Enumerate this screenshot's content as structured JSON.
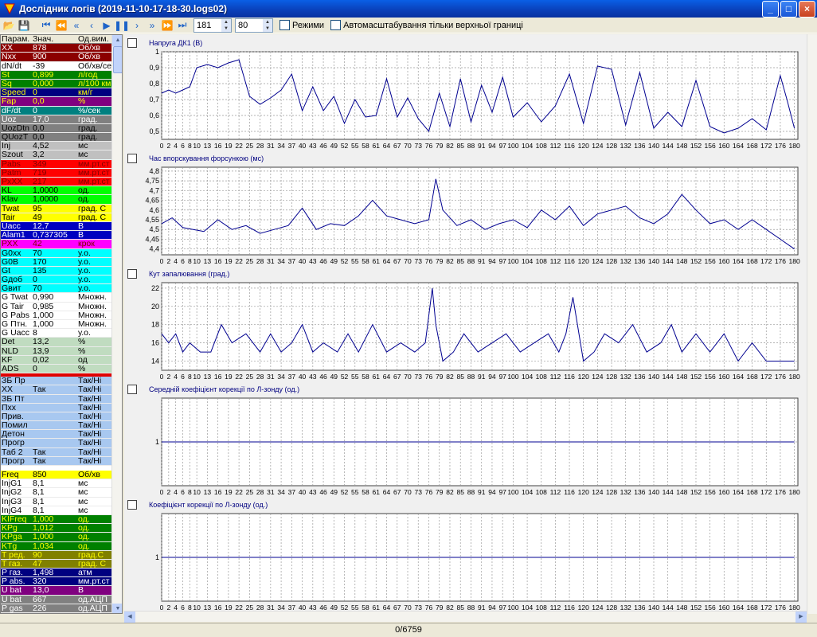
{
  "window": {
    "title": "Дослідник логів (2019-11-10-17-18-30.logs02)",
    "minimize": "_",
    "maximize": "□",
    "close": "×"
  },
  "toolbar": {
    "position_value": "181",
    "window_value": "80",
    "modes_label": "Режими",
    "autoscale_label": "Автомасштабування тільки верхньої границі",
    "icons": [
      "open-folder-icon",
      "save-icon",
      "rewind-to-start-icon",
      "skip-back-icon",
      "fast-back-icon",
      "step-back-icon",
      "play-icon",
      "pause-icon",
      "step-forward-icon",
      "fast-forward-icon",
      "skip-forward-icon",
      "forward-to-end-icon"
    ]
  },
  "params": {
    "headers": [
      "Парам.",
      "Знач.",
      "Од.вим."
    ],
    "rows": [
      {
        "n": "XX",
        "v": "878",
        "u": "Об/хв",
        "c": "#8b0000",
        "t": "#fff"
      },
      {
        "n": "Nxx",
        "v": "900",
        "u": "Об/хв",
        "c": "#8b0000",
        "t": "#fff"
      },
      {
        "n": "dN/dt",
        "v": "-39",
        "u": "Об/хв/сек",
        "c": "#ffffff",
        "t": "#000"
      },
      {
        "n": "St",
        "v": "0,899",
        "u": "л/год",
        "c": "#008000",
        "t": "#ffff00"
      },
      {
        "n": "Sq",
        "v": "0,000",
        "u": "л/100 км",
        "c": "#008000",
        "t": "#ffff00"
      },
      {
        "n": "Speed",
        "v": "0",
        "u": "км/г",
        "c": "#000080",
        "t": "#ffff00"
      },
      {
        "n": "Fap",
        "v": "0,0",
        "u": "%",
        "c": "#800080",
        "t": "#ffff00"
      },
      {
        "n": "dF/dt",
        "v": "0",
        "u": "%/сек",
        "c": "#008080",
        "t": "#fff"
      },
      {
        "n": "Uoz",
        "v": "17,0",
        "u": "град.",
        "c": "#808080",
        "t": "#fff"
      },
      {
        "n": "UozDtn",
        "v": "0,0",
        "u": "град.",
        "c": "#808080",
        "t": "#000"
      },
      {
        "n": "QUozT",
        "v": "0,0",
        "u": "град.",
        "c": "#808080",
        "t": "#000"
      },
      {
        "n": "Inj",
        "v": "4,52",
        "u": "мс",
        "c": "#c0c0c0",
        "t": "#000"
      },
      {
        "n": "Szout",
        "v": "3,2",
        "u": "мс",
        "c": "#c0c0c0",
        "t": "#000"
      },
      {
        "n": "Pabs",
        "v": "349",
        "u": "мм.рт.ст",
        "c": "#ff0000",
        "t": "#800000"
      },
      {
        "n": "Patm",
        "v": "719",
        "u": "мм.рт.ст",
        "c": "#ff0000",
        "t": "#800000"
      },
      {
        "n": "PxXX",
        "v": "217",
        "u": "мм.рт.ст",
        "c": "#ff0000",
        "t": "#800000"
      },
      {
        "n": "KL",
        "v": "1,0000",
        "u": "од.",
        "c": "#00ff00",
        "t": "#000"
      },
      {
        "n": "Klav",
        "v": "1,0000",
        "u": "од.",
        "c": "#00ff00",
        "t": "#000"
      },
      {
        "n": "Twat",
        "v": "95",
        "u": "град. С",
        "c": "#ffff00",
        "t": "#000"
      },
      {
        "n": "Tair",
        "v": "49",
        "u": "град. С",
        "c": "#ffff00",
        "t": "#000"
      },
      {
        "n": "Uacc",
        "v": "12,7",
        "u": "В",
        "c": "#0000c0",
        "t": "#fff"
      },
      {
        "n": "Alam1",
        "v": "0,737305",
        "u": "В",
        "c": "#0000c0",
        "t": "#fff"
      },
      {
        "n": "РХХ",
        "v": "42",
        "u": "крок",
        "c": "#ff00ff",
        "t": "#800000"
      },
      {
        "n": "G0xx",
        "v": "70",
        "u": "у.о.",
        "c": "#00ffff",
        "t": "#000"
      },
      {
        "n": "G0B",
        "v": "170",
        "u": "у.о.",
        "c": "#00ffff",
        "t": "#000"
      },
      {
        "n": "Gt",
        "v": "135",
        "u": "у.о.",
        "c": "#00ffff",
        "t": "#000"
      },
      {
        "n": "Gдоб",
        "v": "0",
        "u": "у.о.",
        "c": "#00ffff",
        "t": "#000"
      },
      {
        "n": "Gвит",
        "v": "70",
        "u": "у.о.",
        "c": "#00ffff",
        "t": "#000"
      },
      {
        "n": "G Twat",
        "v": "0,990",
        "u": "Множн.",
        "c": "#ffffff",
        "t": "#000"
      },
      {
        "n": "G Tair",
        "v": "0,985",
        "u": "Множн.",
        "c": "#ffffff",
        "t": "#000"
      },
      {
        "n": "G Pabs",
        "v": "1,000",
        "u": "Множн.",
        "c": "#ffffff",
        "t": "#000"
      },
      {
        "n": "G Птн.",
        "v": "1,000",
        "u": "Множн.",
        "c": "#ffffff",
        "t": "#000"
      },
      {
        "n": "G Uacc",
        "v": "8",
        "u": "у.о.",
        "c": "#ffffff",
        "t": "#000"
      },
      {
        "n": "Det",
        "v": "13,2",
        "u": "%",
        "c": "#c0dcc0",
        "t": "#000"
      },
      {
        "n": "NLD",
        "v": "13,9",
        "u": "%",
        "c": "#c0dcc0",
        "t": "#000"
      },
      {
        "n": "KF",
        "v": "0,02",
        "u": "од",
        "c": "#c0dcc0",
        "t": "#000"
      },
      {
        "n": "ADS",
        "v": "0",
        "u": "%",
        "c": "#c0dcc0",
        "t": "#000"
      }
    ],
    "flags": [
      {
        "n": "ЗБ Пр",
        "v": "",
        "u": "Так/Ні"
      },
      {
        "n": "XX",
        "v": "Так",
        "u": "Так/Ні"
      },
      {
        "n": "ЗБ Пт",
        "v": "",
        "u": "Так/Ні"
      },
      {
        "n": "Пхх",
        "v": "",
        "u": "Так/Ні"
      },
      {
        "n": "Прив.",
        "v": "",
        "u": "Так/Ні"
      },
      {
        "n": "Помил",
        "v": "",
        "u": "Так/Ні"
      },
      {
        "n": "Детон",
        "v": "",
        "u": "Так/Ні"
      },
      {
        "n": "Прогр",
        "v": "",
        "u": "Так/Ні"
      },
      {
        "n": "Таб 2",
        "v": "Так",
        "u": "Так/Ні"
      },
      {
        "n": "Прогр",
        "v": "Так",
        "u": "Так/Ні"
      }
    ],
    "rows2": [
      {
        "n": "Freq",
        "v": "850",
        "u": "Об/хв",
        "c": "#ffff00",
        "t": "#000"
      },
      {
        "n": "InjG1",
        "v": "8,1",
        "u": "мс",
        "c": "#ffffff",
        "t": "#000"
      },
      {
        "n": "InjG2",
        "v": "8,1",
        "u": "мс",
        "c": "#ffffff",
        "t": "#000"
      },
      {
        "n": "InjG3",
        "v": "8,1",
        "u": "мс",
        "c": "#ffffff",
        "t": "#000"
      },
      {
        "n": "InjG4",
        "v": "8,1",
        "u": "мс",
        "c": "#ffffff",
        "t": "#000"
      },
      {
        "n": "KIFreq",
        "v": "1,000",
        "u": "од.",
        "c": "#008000",
        "t": "#ffff00"
      },
      {
        "n": "KPg",
        "v": "1,012",
        "u": "од.",
        "c": "#008000",
        "t": "#ffff00"
      },
      {
        "n": "KPga",
        "v": "1,000",
        "u": "од.",
        "c": "#008000",
        "t": "#ffff00"
      },
      {
        "n": "KTg",
        "v": "1,034",
        "u": "од.",
        "c": "#008000",
        "t": "#ffff00"
      },
      {
        "n": "T ред.",
        "v": "90",
        "u": "град.С",
        "c": "#808000",
        "t": "#ffff00"
      },
      {
        "n": "T газ.",
        "v": "47",
        "u": "град. С",
        "c": "#808000",
        "t": "#ffff00"
      },
      {
        "n": "P газ.",
        "v": "1,498",
        "u": "атм",
        "c": "#000080",
        "t": "#fff"
      },
      {
        "n": "P abs.",
        "v": "320",
        "u": "мм.рт.ст",
        "c": "#000080",
        "t": "#fff"
      },
      {
        "n": "U bat",
        "v": "13,0",
        "u": "В",
        "c": "#800080",
        "t": "#fff"
      },
      {
        "n": "U bat",
        "v": "667",
        "u": "од.АЦП",
        "c": "#808080",
        "t": "#fff"
      },
      {
        "n": "P gas",
        "v": "226",
        "u": "од.АЦП",
        "c": "#808080",
        "t": "#fff"
      }
    ]
  },
  "chart_data": [
    {
      "type": "line",
      "title": "Напруга ДК1 (В)",
      "ylim": [
        0.45,
        1.0
      ],
      "yticks": [
        0.5,
        0.6,
        0.7,
        0.8,
        0.9,
        1
      ],
      "ytick_labels": [
        "0,5",
        "0,6",
        "0,7",
        "0,8",
        "0,9",
        "1"
      ],
      "x": [
        0,
        2,
        4,
        6,
        8,
        10,
        13,
        16,
        19,
        22,
        25,
        28,
        31,
        34,
        37,
        40,
        43,
        46,
        49,
        52,
        55,
        58,
        61,
        64,
        67,
        70,
        73,
        76,
        79,
        82,
        85,
        88,
        91,
        94,
        97,
        100,
        104,
        108,
        112,
        116,
        120,
        124,
        128,
        132,
        136,
        140,
        144,
        148,
        152,
        156,
        160,
        164,
        168,
        172,
        176,
        178,
        180
      ],
      "values": [
        0.74,
        0.76,
        0.74,
        0.76,
        0.78,
        0.9,
        0.92,
        0.9,
        0.93,
        0.95,
        0.72,
        0.67,
        0.71,
        0.76,
        0.86,
        0.63,
        0.78,
        0.63,
        0.72,
        0.55,
        0.7,
        0.59,
        0.6,
        0.83,
        0.59,
        0.71,
        0.58,
        0.5,
        0.74,
        0.53,
        0.83,
        0.56,
        0.79,
        0.62,
        0.84,
        0.59,
        0.68,
        0.56,
        0.66,
        0.86,
        0.55,
        0.91,
        0.89,
        0.54,
        0.87,
        0.52,
        0.62,
        0.53,
        0.82,
        0.53,
        0.49,
        0.52,
        0.58,
        0.51,
        0.85,
        0.69,
        0.52
      ]
    },
    {
      "type": "line",
      "title": "Час впорскування форсункою (мс)",
      "ylim": [
        4.37,
        4.82
      ],
      "yticks": [
        4.4,
        4.45,
        4.5,
        4.55,
        4.6,
        4.65,
        4.7,
        4.75,
        4.8
      ],
      "ytick_labels": [
        "4,4",
        "4,45",
        "4,5",
        "4,55",
        "4,6",
        "4,65",
        "4,7",
        "4,75",
        "4,8"
      ],
      "x": [
        0,
        3,
        6,
        9,
        12,
        16,
        20,
        24,
        28,
        32,
        36,
        40,
        44,
        48,
        52,
        56,
        60,
        64,
        68,
        72,
        76,
        78,
        80,
        84,
        88,
        92,
        96,
        100,
        104,
        108,
        112,
        116,
        120,
        124,
        128,
        132,
        136,
        140,
        144,
        148,
        152,
        156,
        160,
        164,
        168,
        172,
        176,
        180
      ],
      "values": [
        4.53,
        4.56,
        4.51,
        4.5,
        4.49,
        4.55,
        4.5,
        4.52,
        4.48,
        4.5,
        4.52,
        4.61,
        4.5,
        4.53,
        4.52,
        4.57,
        4.65,
        4.57,
        4.55,
        4.53,
        4.55,
        4.76,
        4.6,
        4.52,
        4.55,
        4.5,
        4.53,
        4.55,
        4.51,
        4.6,
        4.55,
        4.62,
        4.52,
        4.58,
        4.6,
        4.62,
        4.56,
        4.53,
        4.58,
        4.68,
        4.6,
        4.53,
        4.55,
        4.5,
        4.55,
        4.5,
        4.45,
        4.4
      ]
    },
    {
      "type": "line",
      "title": "Кут запалювання (град.)",
      "ylim": [
        13,
        22.6
      ],
      "yticks": [
        14,
        16,
        18,
        20,
        22
      ],
      "ytick_labels": [
        "14",
        "16",
        "18",
        "20",
        "22"
      ],
      "x": [
        0,
        2,
        4,
        6,
        8,
        11,
        14,
        17,
        20,
        24,
        28,
        31,
        34,
        37,
        40,
        43,
        46,
        50,
        53,
        56,
        60,
        64,
        68,
        72,
        75,
        77,
        78,
        80,
        83,
        86,
        90,
        94,
        98,
        102,
        106,
        110,
        113,
        115,
        117,
        120,
        123,
        126,
        130,
        134,
        138,
        142,
        145,
        148,
        152,
        156,
        160,
        164,
        168,
        172,
        176,
        180
      ],
      "values": [
        17,
        16,
        17,
        15,
        16,
        15,
        15,
        18,
        16,
        17,
        15,
        17,
        15,
        16,
        18,
        15,
        16,
        15,
        17,
        15,
        18,
        15,
        16,
        15,
        16,
        22,
        18,
        14,
        15,
        17,
        15,
        16,
        17,
        15,
        16,
        17,
        15,
        17,
        21,
        14,
        15,
        17,
        16,
        18,
        15,
        16,
        18,
        15,
        17,
        15,
        17,
        14,
        16,
        14,
        14,
        14
      ]
    },
    {
      "type": "line",
      "title": "Середній коефіцієнт корекції по Л-зонду (од.)",
      "ylim": [
        0,
        2
      ],
      "yticks": [
        1
      ],
      "ytick_labels": [
        "1"
      ],
      "x": [
        0,
        180
      ],
      "values": [
        1,
        1
      ]
    },
    {
      "type": "line",
      "title": "Коефіцієнт корекції по Л-зонду (од.)",
      "ylim": [
        0,
        2
      ],
      "yticks": [
        1
      ],
      "ytick_labels": [
        "1"
      ],
      "x": [
        0,
        180
      ],
      "values": [
        1,
        1
      ]
    }
  ],
  "x_axis": {
    "xlim": [
      0,
      181
    ],
    "ticks": [
      0,
      2,
      4,
      6,
      8,
      10,
      13,
      16,
      19,
      22,
      25,
      28,
      31,
      34,
      37,
      40,
      43,
      46,
      49,
      52,
      55,
      58,
      61,
      64,
      67,
      70,
      73,
      76,
      79,
      82,
      85,
      88,
      91,
      94,
      97,
      100,
      104,
      108,
      112,
      116,
      120,
      124,
      128,
      132,
      136,
      140,
      144,
      148,
      152,
      156,
      160,
      164,
      168,
      172,
      176,
      180
    ],
    "tick_labels": [
      "0",
      "2",
      "4",
      "6",
      "8",
      "10",
      "13",
      "16",
      "19",
      "22",
      "25",
      "28",
      "31",
      "34",
      "37",
      "40",
      "43",
      "46",
      "49",
      "52",
      "55",
      "58",
      "61",
      "64",
      "67",
      "70",
      "73",
      "76",
      "79",
      "82",
      "85",
      "88",
      "91",
      "94",
      "97",
      "100",
      "104",
      "108",
      "112",
      "116",
      "120",
      "124",
      "128",
      "132",
      "136",
      "140",
      "144",
      "148",
      "152",
      "156",
      "160",
      "164",
      "168",
      "172",
      "176",
      "180"
    ],
    "gridlines": [
      0,
      2,
      4,
      6,
      8,
      10,
      13,
      16,
      19,
      22,
      25,
      28,
      31,
      34,
      37,
      40,
      43,
      46,
      49,
      52,
      55,
      58,
      61,
      64,
      67,
      70,
      73,
      76,
      79,
      82,
      85,
      88,
      91,
      94,
      97,
      100,
      104,
      108,
      112,
      116,
      120,
      124,
      128,
      132,
      136,
      140,
      144,
      148,
      152,
      156,
      160,
      164,
      168,
      172,
      176,
      180
    ]
  },
  "colors": {
    "line": "#000090",
    "grid": "#9a9a9a",
    "plot_bg": "#ffffff"
  },
  "status": {
    "text": "0/6759"
  }
}
